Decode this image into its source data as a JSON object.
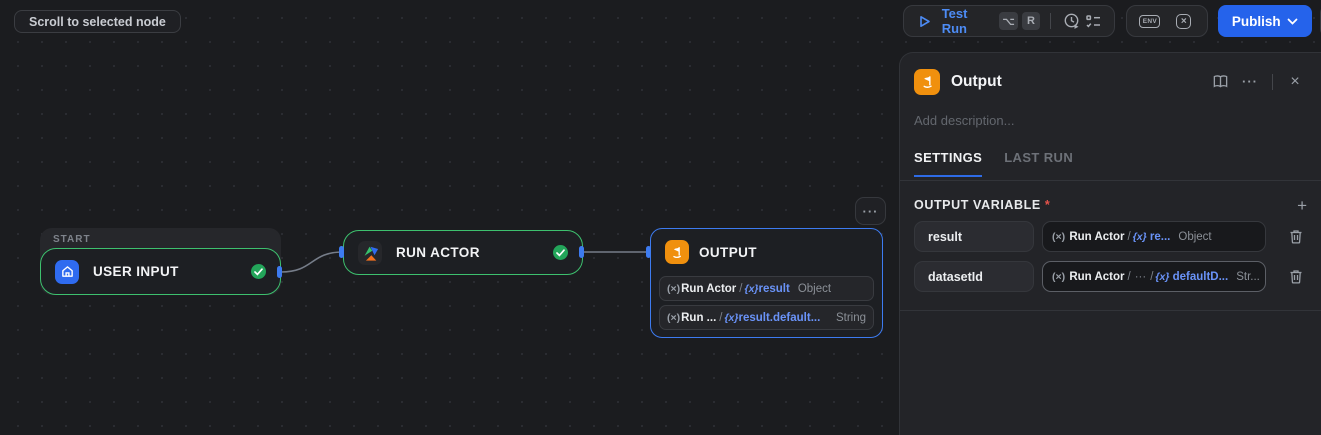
{
  "top_bar": {
    "scroll_to_node_label": "Scroll to selected node",
    "test_run": {
      "label": "Test Run",
      "shortcut_alt": "⌥",
      "shortcut_key": "R"
    },
    "publish_label": "Publish",
    "icons": {
      "play": "play-outline",
      "run-schedule": "clock-play",
      "run-config": "checklist",
      "env": "ENV",
      "variables": "x",
      "history": "clock-restore"
    }
  },
  "canvas": {
    "start_group_label": "START",
    "user_input": {
      "title": "USER INPUT"
    },
    "run_actor": {
      "title": "RUN ACTOR"
    },
    "output_node": {
      "title": "OUTPUT",
      "more_label": "···",
      "chips": [
        {
          "var_icon": "(×)",
          "source": "Run Actor",
          "slash": "/",
          "fx_icon": "{x}",
          "path": "result",
          "type": "Object"
        },
        {
          "var_icon": "(×)",
          "source": "Run ...",
          "slash": "/",
          "fx_icon": "{x}",
          "path": "result.default...",
          "type": "String"
        }
      ]
    }
  },
  "panel": {
    "title": "Output",
    "more_label": "···",
    "close_label": "×",
    "description_placeholder": "Add description...",
    "tabs": {
      "settings": "SETTINGS",
      "last_run": "LAST RUN"
    },
    "output_variable": {
      "label": "OUTPUT VARIABLE",
      "required": "*",
      "add_label": "+",
      "rows": [
        {
          "name": "result",
          "var_icon": "(×)",
          "source": "Run Actor",
          "slash": "/",
          "fx_icon": "{x}",
          "path": "re...",
          "type": "Object"
        },
        {
          "name": "datasetId",
          "var_icon": "(×)",
          "source": "Run Actor",
          "slash": "/",
          "ellipsis": "···",
          "slash2": "/",
          "fx_icon": "{x}",
          "path": "defaultD...",
          "type": "Str..."
        }
      ]
    }
  },
  "colors": {
    "accent_blue": "#2e6be6",
    "node_green": "#3dc06e",
    "node_blue": "#3d7bf0",
    "orange": "#f0900e",
    "success_green": "#23a55a",
    "danger_red": "#e5534b",
    "link_blue": "#6a93f8"
  }
}
